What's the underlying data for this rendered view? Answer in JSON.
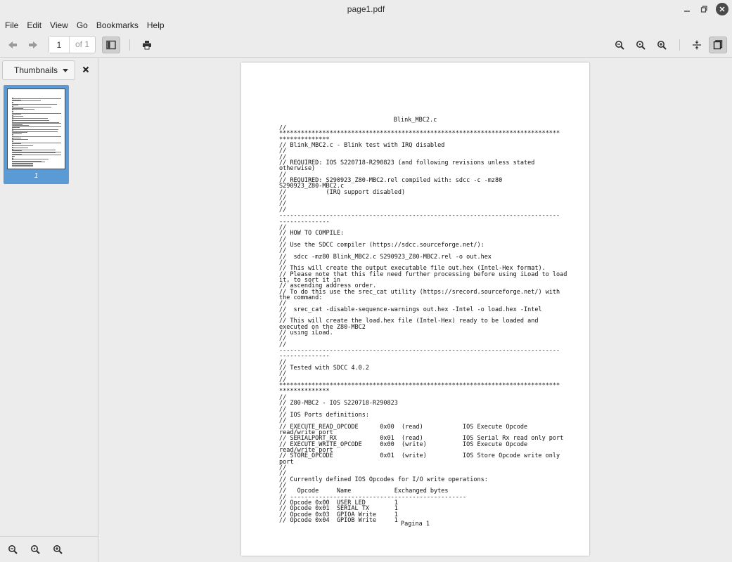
{
  "window": {
    "title": "page1.pdf"
  },
  "menu": [
    "File",
    "Edit",
    "View",
    "Go",
    "Bookmarks",
    "Help"
  ],
  "toolbar": {
    "page_value": "1",
    "page_of": "of 1"
  },
  "sidebar": {
    "mode_label": "Thumbnails",
    "thumbnail_label": "1"
  },
  "document": {
    "title": "Blink_MBC2.c",
    "footer": "Pagina 1",
    "lines": [
      "//",
      "******************************************************************************",
      "**************",
      "// Blink_MBC2.c - Blink test with IRQ disabled",
      "//",
      "//",
      "// REQUIRED: IOS S220718-R290823 (and following revisions unless stated",
      "otherwise)",
      "//",
      "// REQUIRED: S290923_Z80-MBC2.rel compiled with: sdcc -c -mz80",
      "S290923_Z80-MBC2.c",
      "//           (IRQ support disabled)",
      "//",
      "//",
      "//",
      "------------------------------------------------------------------------------",
      "--------------",
      "//",
      "// HOW TO COMPILE:",
      "//",
      "// Use the SDCC compiler (https://sdcc.sourceforge.net/):",
      "//",
      "//  sdcc -mz80 Blink_MBC2.c S290923_Z80-MBC2.rel -o out.hex",
      "//",
      "// This will create the output executable file out.hex (Intel-Hex format).",
      "// Please note that this file need further processing before using iLoad to load",
      "it, to sort it in",
      "// ascending address order.",
      "// To do this use the srec_cat utility (https://srecord.sourceforge.net/) with",
      "the command:",
      "//",
      "//  srec_cat -disable-sequence-warnings out.hex -Intel -o load.hex -Intel",
      "//",
      "// This will create the load.hex file (Intel-Hex) ready to be loaded and",
      "executed on the Z80-MBC2",
      "// using iLoad.",
      "//",
      "//",
      "------------------------------------------------------------------------------",
      "--------------",
      "//",
      "// Tested with SDCC 4.0.2",
      "//",
      "//",
      "******************************************************************************",
      "**************",
      "//",
      "// Z80-MBC2 - IOS S220718-R290823",
      "//",
      "// IOS Ports definitions:",
      "//",
      "// EXECUTE_READ_OPCODE      0x00  (read)           IOS Execute Opcode",
      "read/write port",
      "// SERIALPORT_RX            0x01  (read)           IOS Serial Rx read only port",
      "// EXECUTE_WRITE_OPCODE     0x00  (write)          IOS Execute Opcode",
      "read/write port",
      "// STORE_OPCODE             0x01  (write)          IOS Store Opcode write only",
      "port",
      "//",
      "//",
      "// Currently defined IOS Opcodes for I/O write operations:",
      "//",
      "//   Opcode     Name            Exchanged bytes",
      "// -------------------------------------------------",
      "// Opcode 0x00  USER LED        1",
      "// Opcode 0x01  SERIAL TX       1",
      "// Opcode 0x03  GPIOA Write     1",
      "// Opcode 0x04  GPIOB Write     1"
    ]
  }
}
